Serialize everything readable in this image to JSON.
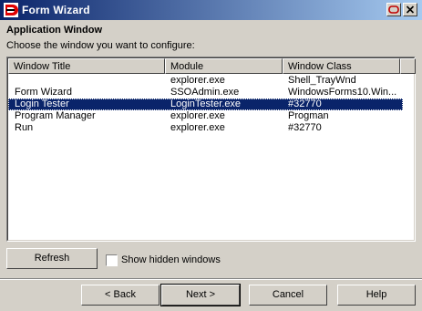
{
  "window": {
    "title": "Form Wizard"
  },
  "section": {
    "title": "Application Window",
    "subtitle": "Choose the window you want to configure:"
  },
  "table": {
    "columns": [
      "Window Title",
      "Module",
      "Window Class"
    ],
    "rows": [
      [
        "",
        "explorer.exe",
        "Shell_TrayWnd"
      ],
      [
        "Form Wizard",
        "SSOAdmin.exe",
        "WindowsForms10.Win..."
      ],
      [
        "Login Tester",
        "LoginTester.exe",
        "#32770"
      ],
      [
        "Program Manager",
        "explorer.exe",
        "Progman"
      ],
      [
        "Run",
        "explorer.exe",
        "#32770"
      ]
    ],
    "selected_row": 2
  },
  "refresh_label": "Refresh",
  "show_hidden": {
    "label": "Show hidden windows",
    "checked": false
  },
  "nav": {
    "back": "< Back",
    "next": "Next >",
    "cancel": "Cancel",
    "help": "Help"
  },
  "colors": {
    "titlebar_start": "#0a246a",
    "titlebar_end": "#a6caf0",
    "selection": "#0a246a",
    "face": "#d4d0c8"
  },
  "icons": [
    "app-logo-icon",
    "restore-icon",
    "close-icon"
  ]
}
